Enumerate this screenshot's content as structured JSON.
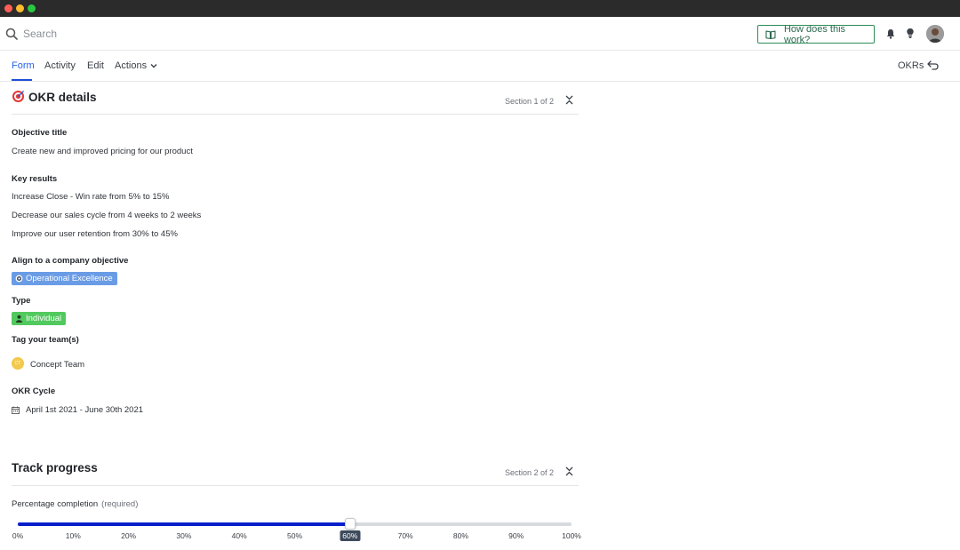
{
  "window": {
    "traffic_lights": [
      "close",
      "minimize",
      "zoom"
    ]
  },
  "topbar": {
    "search_placeholder": "Search",
    "help_label": "How does this work?",
    "icons": [
      "search-icon",
      "book-icon",
      "bell-icon",
      "lightbulb-icon",
      "avatar"
    ]
  },
  "tabs": {
    "items": [
      {
        "label": "Form",
        "active": true
      },
      {
        "label": "Activity",
        "active": false
      },
      {
        "label": "Edit",
        "active": false
      },
      {
        "label": "Actions",
        "active": false
      }
    ],
    "right_link": "OKRs"
  },
  "section1": {
    "title": "OKR details",
    "counter": "Section 1 of 2",
    "objective_label": "Objective title",
    "objective_value": "Create new and improved pricing for our product",
    "key_results_label": "Key results",
    "key_results": [
      "Increase Close - Win rate from 5% to 15%",
      "Decrease our sales cycle from 4 weeks to 2 weeks",
      "Improve our user retention from 30% to 45%"
    ],
    "align_label": "Align to a company objective",
    "align_value": "Operational Excellence",
    "type_label": "Type",
    "type_value": "Individual",
    "teams_label": "Tag your team(s)",
    "team_name": "Concept Team",
    "cycle_label": "OKR Cycle",
    "cycle_value": "April 1st 2021 - June 30th 2021"
  },
  "section2": {
    "title": "Track progress",
    "counter": "Section 2 of 2",
    "completion_label": "Percentage completion",
    "completion_required": "(required)",
    "completion_value": 60,
    "ticks": [
      "0%",
      "10%",
      "20%",
      "30%",
      "40%",
      "50%",
      "60%",
      "70%",
      "80%",
      "90%",
      "100%"
    ]
  },
  "colors": {
    "accent": "#1d4ed8",
    "slider_fill": "#0a1fcc",
    "help_border": "#2e8b57",
    "tag_blue": "#6a9ce6",
    "tag_green": "#52c95e",
    "team_dot": "#f2c94c"
  }
}
